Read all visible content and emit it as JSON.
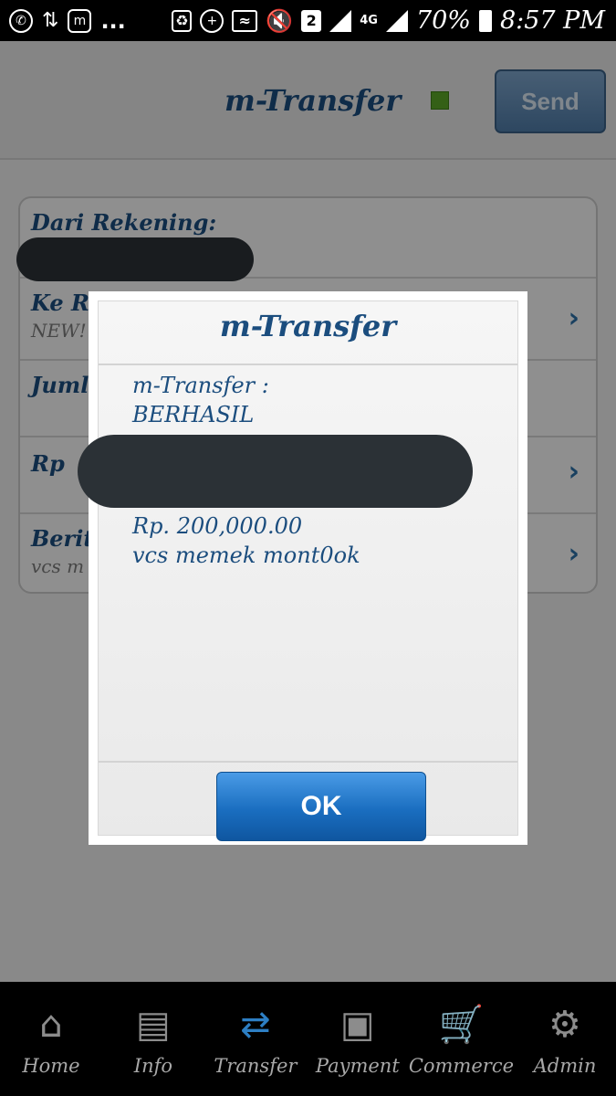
{
  "status_bar": {
    "left_icons": [
      "whatsapp-icon",
      "transfer-icon",
      "messenger-icon"
    ],
    "more": "...",
    "network": "4G",
    "sim_badge": "2",
    "battery": "70%",
    "time": "8:57 PM"
  },
  "header": {
    "title": "m-Transfer",
    "send_label": "Send",
    "status_color": "#5aa626"
  },
  "form": {
    "from_label": "Dari Rekening:",
    "to_label": "Ke Re",
    "to_sub": "NEW!",
    "amount_label": "Jumla",
    "currency_label": "Rp",
    "note_label": "Berita",
    "note_sub": "vcs m"
  },
  "dialog": {
    "title": "m-Transfer",
    "line1": "m-Transfer :",
    "line2": "BERHASIL",
    "amount": "Rp. 200,000.00",
    "message": "vcs memek mont0ok",
    "ok_label": "OK"
  },
  "nav": {
    "items": [
      {
        "label": "Home",
        "icon": "home-icon"
      },
      {
        "label": "Info",
        "icon": "info-icon"
      },
      {
        "label": "Transfer",
        "icon": "transfer-icon"
      },
      {
        "label": "Payment",
        "icon": "payment-icon"
      },
      {
        "label": "Commerce",
        "icon": "cart-icon"
      },
      {
        "label": "Admin",
        "icon": "admin-icon"
      }
    ]
  }
}
